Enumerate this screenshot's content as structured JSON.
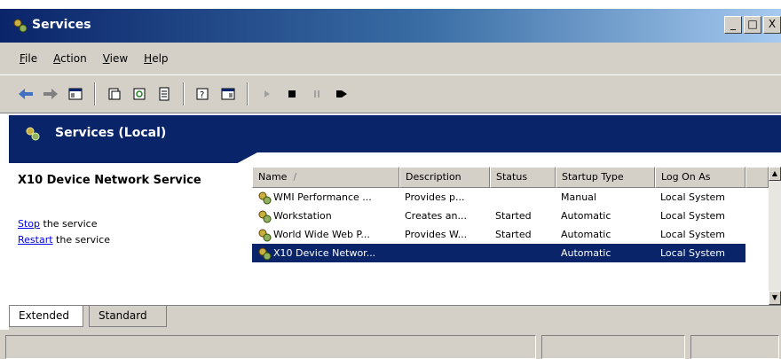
{
  "window": {
    "title": "Services"
  },
  "menu": [
    {
      "label": "File",
      "accel": "F",
      "rest": "ile"
    },
    {
      "label": "Action",
      "accel": "A",
      "rest": "ction"
    },
    {
      "label": "View",
      "accel": "V",
      "rest": "iew"
    },
    {
      "label": "Help",
      "accel": "H",
      "rest": "elp"
    }
  ],
  "window_buttons": {
    "minimize": "_",
    "maximize": "□",
    "close": "X"
  },
  "scope": {
    "title": "Services (Local)"
  },
  "details": {
    "service_name": "X10 Device Network Service",
    "stop_link": "Stop",
    "stop_rest": " the service",
    "restart_link": "Restart",
    "restart_rest": " the service"
  },
  "list": {
    "columns": [
      "Name",
      "Description",
      "Status",
      "Startup Type",
      "Log On As"
    ],
    "sort_indicator": "/",
    "rows": [
      [
        "WMI Performance ...",
        "Provides p...",
        "",
        "Manual",
        "Local System"
      ],
      [
        "Workstation",
        "Creates an...",
        "Started",
        "Automatic",
        "Local System"
      ],
      [
        "World Wide Web P...",
        "Provides W...",
        "Started",
        "Automatic",
        "Local System"
      ],
      [
        "X10 Device Networ...",
        "",
        "",
        "Automatic",
        "Local System"
      ]
    ],
    "selected_row": 3
  },
  "tabs": {
    "extended": "Extended",
    "standard": "Standard"
  },
  "colors": {
    "title_bar": "#0a246a",
    "selection": "#0a246a",
    "chrome": "#d4d0c8"
  },
  "icons": [
    "services-icon",
    "back-icon",
    "forward-icon",
    "show-hide-console-tree-icon",
    "properties-icon",
    "refresh-icon",
    "export-list-icon",
    "help-icon",
    "console-icon",
    "play-icon",
    "stop-icon",
    "pause-icon",
    "restart-icon",
    "gear-service-icon"
  ]
}
